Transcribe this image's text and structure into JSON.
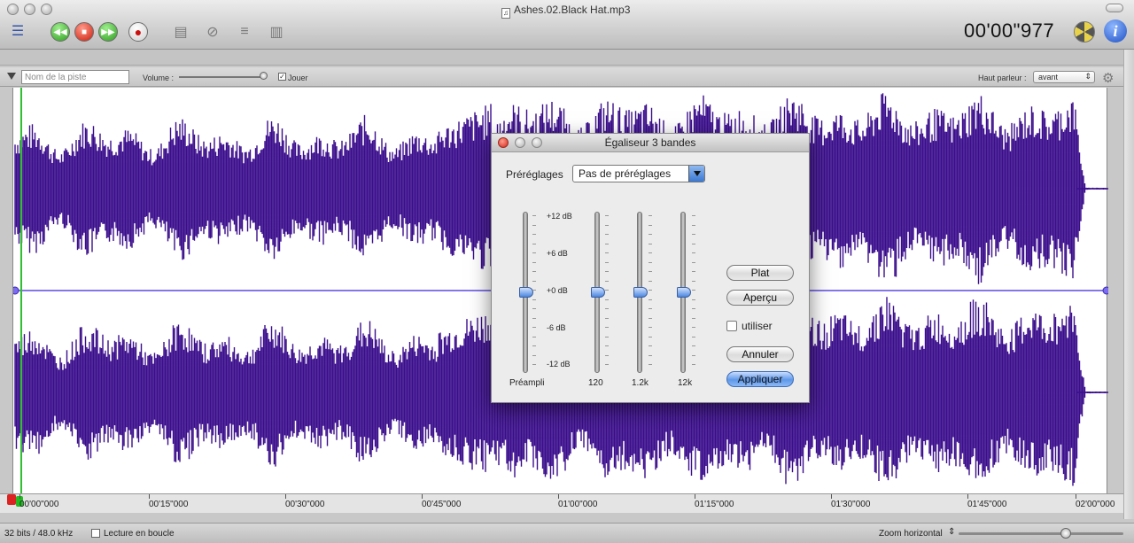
{
  "window": {
    "title": "Ashes.02.Black Hat.mp3",
    "timecode": "00'00\"977"
  },
  "toolbar": {
    "buttons": [
      "waveform-toggle",
      "rewind",
      "stop",
      "fast-forward",
      "record",
      "add-track",
      "remove-track",
      "mixer",
      "export"
    ]
  },
  "track": {
    "name_placeholder": "Nom de la piste",
    "volume_label": "Volume :",
    "volume_level": 0.97,
    "play_checked": true,
    "play_label": "Jouer",
    "speaker_label": "Haut parleur :",
    "speaker_value": "avant"
  },
  "timeline": {
    "ticks": [
      "00'00\"000",
      "00'15\"000",
      "00'30\"000",
      "00'45\"000",
      "01'00\"000",
      "01'15\"000",
      "01'30\"000",
      "01'45\"000",
      "02'00\"000"
    ]
  },
  "status": {
    "format": "32 bits / 48.0 kHz",
    "loop_label": "Lecture en boucle",
    "loop_checked": false,
    "zoom_label": "Zoom horizontal",
    "zoom_level": 0.65
  },
  "equalizer": {
    "title": "Égaliseur 3 bandes",
    "presets_label": "Préréglages",
    "preset_value": "Pas de préréglages",
    "db_labels": [
      "+12 dB",
      "+6 dB",
      "+0 dB",
      "-6 dB",
      "-12 dB"
    ],
    "bands": [
      {
        "label": "Préampli",
        "gain_db": 0
      },
      {
        "label": "120",
        "gain_db": 0
      },
      {
        "label": "1.2k",
        "gain_db": 0
      },
      {
        "label": "12k",
        "gain_db": 0
      }
    ],
    "buttons": {
      "flat": "Plat",
      "preview": "Aperçu",
      "use": "utiliser",
      "cancel": "Annuler",
      "apply": "Appliquer"
    }
  },
  "colors": {
    "waveform": "#3b0e8c",
    "playhead": "#2fbf2f",
    "center_line": "#5a4ae0"
  }
}
